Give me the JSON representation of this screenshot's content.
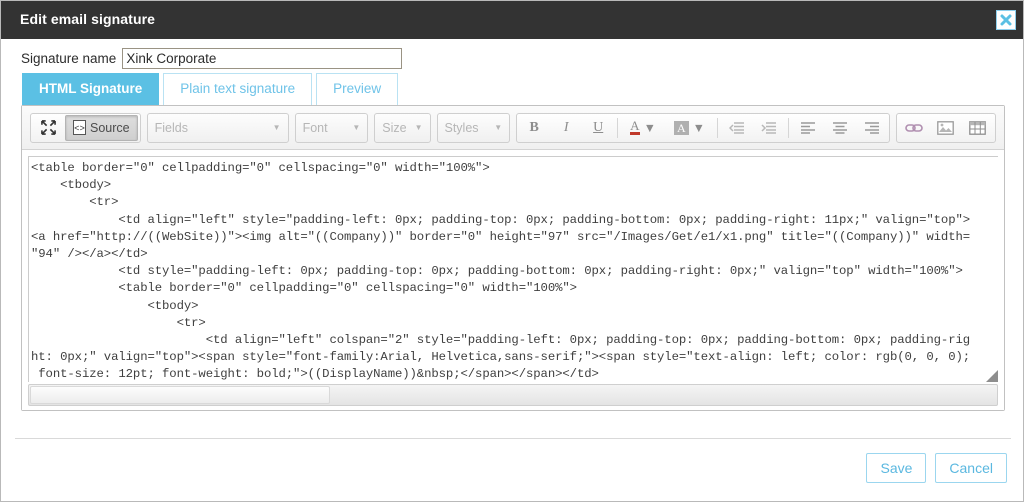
{
  "window": {
    "title": "Edit email signature",
    "close_icon": "close-x-icon"
  },
  "signature_name": {
    "label": "Signature name",
    "value": "Xink Corporate",
    "placeholder": ""
  },
  "tabs": [
    {
      "label": "HTML Signature",
      "active": true
    },
    {
      "label": "Plain text signature",
      "active": false
    },
    {
      "label": "Preview",
      "active": false
    }
  ],
  "toolbar": {
    "maximize_label": "",
    "maximize_icon": "maximize-arrows-icon",
    "source_label": "Source",
    "source_icon": "source-code-icon",
    "fields_label": "Fields",
    "font_label": "Font",
    "size_label": "Size",
    "styles_label": "Styles",
    "bold_label": "B",
    "italic_label": "I",
    "underline_label": "U",
    "text_color_label": "A",
    "bg_color_label": "A",
    "caret": "▼",
    "icons": {
      "outdent": "decrease-indent-icon",
      "indent": "increase-indent-icon",
      "align_left": "align-left-icon",
      "align_center": "align-center-icon",
      "align_right": "align-right-icon",
      "link": "link-icon",
      "image": "image-icon",
      "table": "table-icon"
    }
  },
  "editor": {
    "code": "<table border=\"0\" cellpadding=\"0\" cellspacing=\"0\" width=\"100%\">\n    <tbody>\n        <tr>\n            <td align=\"left\" style=\"padding-left: 0px; padding-top: 0px; padding-bottom: 0px; padding-right: 11px;\" valign=\"top\">\n<a href=\"http://((WebSite))\"><img alt=\"((Company))\" border=\"0\" height=\"97\" src=\"/Images/Get/e1/x1.png\" title=\"((Company))\" width=\n\"94\" /></a></td>\n            <td style=\"padding-left: 0px; padding-top: 0px; padding-bottom: 0px; padding-right: 0px;\" valign=\"top\" width=\"100%\">\n            <table border=\"0\" cellpadding=\"0\" cellspacing=\"0\" width=\"100%\">\n                <tbody>\n                    <tr>\n                        <td align=\"left\" colspan=\"2\" style=\"padding-left: 0px; padding-top: 0px; padding-bottom: 0px; padding-rig\nht: 0px;\" valign=\"top\"><span style=\"font-family:Arial, Helvetica,sans-serif;\"><span style=\"text-align: left; color: rgb(0, 0, 0);\n font-size: 12pt; font-weight: bold;\">((DisplayName))&nbsp;</span></span></td>\n                    </tr>\n                    <tr>\n",
    "scroll_thumb_label": "horizontal-scrollbar",
    "resize_grip_label": "resize-grip"
  },
  "footer": {
    "save_label": "Save",
    "cancel_label": "Cancel"
  },
  "colors": {
    "titlebar_bg": "#333333",
    "accent": "#5bc0e4",
    "tab_border": "#b9e2f3",
    "button_text": "#5bb8e0"
  }
}
